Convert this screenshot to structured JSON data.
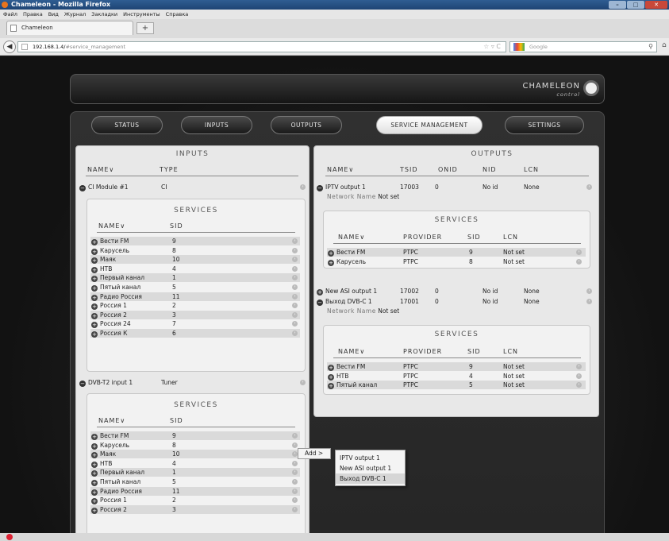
{
  "browser": {
    "title": "Chameleon - Mozilla Firefox",
    "menu": [
      "Файл",
      "Правка",
      "Вид",
      "Журнал",
      "Закладки",
      "Инструменты",
      "Справка"
    ],
    "tab": "Chameleon",
    "url_host": "192.168.1.4/",
    "url_path": "#service_management",
    "search_placeholder": "Google"
  },
  "app": {
    "logo": "CHAMELEON",
    "logo_sub": "control"
  },
  "nav": [
    "STATUS",
    "INPUTS",
    "OUTPUTS",
    "SERVICE MANAGEMENT",
    "SETTINGS"
  ],
  "inputs": {
    "title": "INPUTS",
    "col_name": "NAME∨",
    "col_type": "TYPE",
    "module1": {
      "name": "CI Module #1",
      "type": "CI"
    },
    "module2": {
      "name": "DVB-T2 input 1",
      "type": "Tuner"
    },
    "services_title": "SERVICES",
    "col_sname": "NAME∨",
    "col_sid": "SID",
    "services1": [
      {
        "name": "Вести FM",
        "sid": "9"
      },
      {
        "name": "Карусель",
        "sid": "8"
      },
      {
        "name": "Маяк",
        "sid": "10"
      },
      {
        "name": "НТВ",
        "sid": "4"
      },
      {
        "name": "Первый канал",
        "sid": "1"
      },
      {
        "name": "Пятый канал",
        "sid": "5"
      },
      {
        "name": "Радио Россия",
        "sid": "11"
      },
      {
        "name": "Россия 1",
        "sid": "2"
      },
      {
        "name": "Россия 2",
        "sid": "3"
      },
      {
        "name": "Россия 24",
        "sid": "7"
      },
      {
        "name": "Россия К",
        "sid": "6"
      }
    ],
    "services2": [
      {
        "name": "Вести FM",
        "sid": "9"
      },
      {
        "name": "Карусель",
        "sid": "8"
      },
      {
        "name": "Маяк",
        "sid": "10"
      },
      {
        "name": "НТВ",
        "sid": "4"
      },
      {
        "name": "Первый канал",
        "sid": "1"
      },
      {
        "name": "Пятый канал",
        "sid": "5"
      },
      {
        "name": "Радио Россия",
        "sid": "11"
      },
      {
        "name": "Россия 1",
        "sid": "2"
      },
      {
        "name": "Россия 2",
        "sid": "3"
      }
    ]
  },
  "outputs": {
    "title": "OUTPUTS",
    "cols": [
      "NAME∨",
      "TSID",
      "ONID",
      "NID",
      "LCN"
    ],
    "network_label": "Network Name",
    "network_value": "Not set",
    "rows": [
      {
        "name": "IPTV output 1",
        "tsid": "17003",
        "onid": "0",
        "nid": "No id",
        "lcn": "None"
      },
      {
        "name": "New ASI output 1",
        "tsid": "17002",
        "onid": "0",
        "nid": "No id",
        "lcn": "None"
      },
      {
        "name": "Выход DVB-C 1",
        "tsid": "17001",
        "onid": "0",
        "nid": "No id",
        "lcn": "None"
      }
    ],
    "services_title": "SERVICES",
    "scols": [
      "NAME∨",
      "PROVIDER",
      "SID",
      "LCN"
    ],
    "services1": [
      {
        "name": "Вести FM",
        "provider": "РТРС",
        "sid": "9",
        "lcn": "Not set"
      },
      {
        "name": "Карусель",
        "provider": "РТРС",
        "sid": "8",
        "lcn": "Not set"
      }
    ],
    "services3": [
      {
        "name": "Вести FM",
        "provider": "РТРС",
        "sid": "9",
        "lcn": "Not set"
      },
      {
        "name": "НТВ",
        "provider": "РТРС",
        "sid": "4",
        "lcn": "Not set"
      },
      {
        "name": "Пятый канал",
        "provider": "РТРС",
        "sid": "5",
        "lcn": "Not set"
      }
    ]
  },
  "context": {
    "add_label": "Add >",
    "items": [
      "IPTV output 1",
      "New ASI output 1",
      "Выход DVB-C 1"
    ]
  }
}
